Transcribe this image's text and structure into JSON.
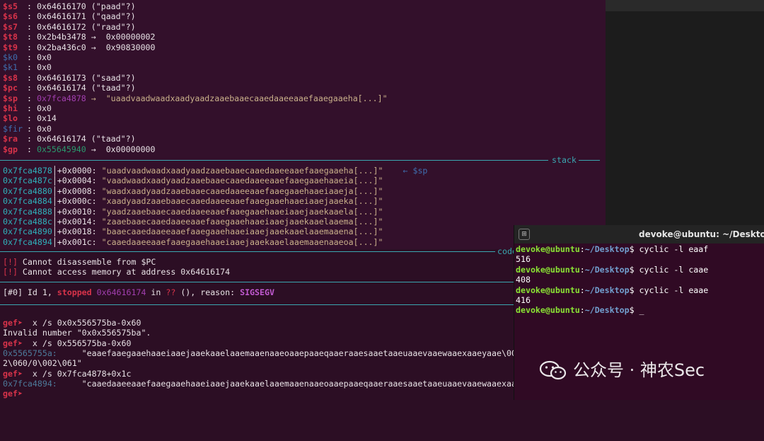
{
  "registers": [
    {
      "name": "$s5",
      "value": "0x64616170",
      "extra": "(\"paad\"?)",
      "style": "red"
    },
    {
      "name": "$s6",
      "value": "0x64616171",
      "extra": "(\"qaad\"?)",
      "style": "red"
    },
    {
      "name": "$s7",
      "value": "0x64616172",
      "extra": "(\"raad\"?)",
      "style": "red"
    },
    {
      "name": "$t8",
      "value": "0x2b4b3478",
      "extra": "→  0x00000002",
      "style": "red"
    },
    {
      "name": "$t9",
      "value": "0x2ba436c0",
      "extra": "→  0x90830000",
      "style": "red"
    },
    {
      "name": "$k0",
      "value": "0x0",
      "extra": "",
      "style": "blue"
    },
    {
      "name": "$k1",
      "value": "0x0",
      "extra": "",
      "style": "blue"
    },
    {
      "name": "$s8",
      "value": "0x64616173",
      "extra": "(\"saad\"?)",
      "style": "red"
    },
    {
      "name": "$pc",
      "value": "0x64616174",
      "extra": "(\"taad\"?)",
      "style": "red"
    },
    {
      "name": "$sp",
      "value": "0x7fca4878",
      "extra": "→  \"uaadvaadwaadxaadyaadzaaebaaecaaedaaeeaaefaaegaaeha[...]\"",
      "style": "red-sp"
    },
    {
      "name": "$hi",
      "value": "0x0",
      "extra": "",
      "style": "red"
    },
    {
      "name": "$lo",
      "value": "0x14",
      "extra": "",
      "style": "red"
    },
    {
      "name": "$fir",
      "value": "0x0",
      "extra": "",
      "style": "blue"
    },
    {
      "name": "$ra",
      "value": "0x64616174",
      "extra": "(\"taad\"?)",
      "style": "red"
    },
    {
      "name": "$gp",
      "value": "0x55645940",
      "extra": "→  0x00000000",
      "style": "red-gp"
    }
  ],
  "stack_label": "stack",
  "stack_rows": [
    {
      "addr": "0x7fca4878",
      "off": "+0x0000:",
      "data": "\"uaadvaadwaadxaadyaadzaaebaaecaaedaaeeaaefaaegaaeha[...]\"",
      "note": "← $sp"
    },
    {
      "addr": "0x7fca487c",
      "off": "+0x0004:",
      "data": "\"vaadwaadxaadyaadzaaebaaecaaedaaeeaaefaaegaaehaaeia[...]\"",
      "note": ""
    },
    {
      "addr": "0x7fca4880",
      "off": "+0x0008:",
      "data": "\"waadxaadyaadzaaebaaecaaedaaeeaaefaaegaaehaaeiaaeja[...]\"",
      "note": ""
    },
    {
      "addr": "0x7fca4884",
      "off": "+0x000c:",
      "data": "\"xaadyaadzaaebaaecaaedaaeeaaefaaegaaehaaeiaaejaaeka[...]\"",
      "note": ""
    },
    {
      "addr": "0x7fca4888",
      "off": "+0x0010:",
      "data": "\"yaadzaaebaaecaaedaaeeaaefaaegaaehaaeiaaejaaekaaela[...]\"",
      "note": ""
    },
    {
      "addr": "0x7fca488c",
      "off": "+0x0014:",
      "data": "\"zaaebaaecaaedaaeeaaefaaegaaehaaeiaaejaaekaaelaaema[...]\"",
      "note": ""
    },
    {
      "addr": "0x7fca4890",
      "off": "+0x0018:",
      "data": "\"baaecaaedaaeeaaefaaegaaehaaeiaaejaaekaaelaaemaaena[...]\"",
      "note": ""
    },
    {
      "addr": "0x7fca4894",
      "off": "+0x001c:",
      "data": "\"caaedaaeeaaefaaegaaehaaeiaaejaaekaaelaaemaaenaaeoa[...]\"",
      "note": ""
    }
  ],
  "code_label": "code",
  "errors": [
    {
      "tag": "[!]",
      "text": " Cannot disassemble from $PC"
    },
    {
      "tag": "[!]",
      "text": " Cannot access memory at address 0x64616174"
    }
  ],
  "thread": {
    "prefix": "[#0] Id 1, ",
    "stopped": "stopped",
    "addr": "0x64616174",
    "in": " in ",
    "func": "??",
    "reason_label": " (), reason: ",
    "reason": "SIGSEGV"
  },
  "console": {
    "prompt": "gef➤",
    "cmd1": "  x /s 0x0x556575ba-0x60",
    "out1": "Invalid number \"0x0x556575ba\".",
    "cmd2": "  x /s 0x556575ba-0x60",
    "addr2": "0x5565755a:",
    "out2": "     \"eaaefaaegaaehaaeiaaejaaekaaelaaemaaenaaeoaaepaaeqaaeraaesaaetaaeuaaevaaewaaexaaeyaae\\002",
    "out2b": "2\\060/0\\002\\061\"",
    "cmd3": "  x /s 0x7fca4878+0x1c",
    "addr3": "0x7fca4894:",
    "out3": "     \"caaedaaeeaaefaaegaaehaaeiaaejaaekaaelaaemaaenaaeoaaepaaeqaaeraaesaaetaaeuaaevaaewaaexaae"
  },
  "terminal": {
    "title": "devoke@ubuntu: ~/Desktop",
    "user": "devoke@ubuntu",
    "path": "~/Desktop",
    "lines": [
      {
        "cmd": " cyclic -l eaaf",
        "out": "516"
      },
      {
        "cmd": " cyclic -l caae",
        "out": "408"
      },
      {
        "cmd": " cyclic -l eaae",
        "out": "416"
      }
    ],
    "last_prompt_tail": " _"
  },
  "watermark": "公众号 · 神农Sec"
}
